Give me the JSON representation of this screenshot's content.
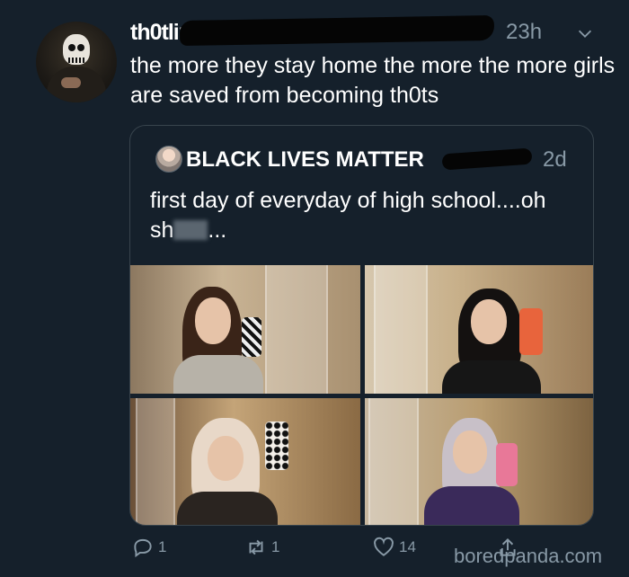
{
  "tweet": {
    "handle_fragment": "th0tline ...",
    "time": "23h",
    "text": "the more they stay home the more the more girls are saved from becoming th0ts"
  },
  "quoted_tweet": {
    "name": "BLACK LIVES MATTER",
    "time": "2d",
    "text_before": "first day of everyday of high school....oh sh",
    "text_after": "..."
  },
  "actions": {
    "reply_count": "1",
    "retweet_count": "1",
    "like_count": "14"
  },
  "watermark": "boredpanda.com",
  "icons": [
    "reply-icon",
    "retweet-icon",
    "like-icon",
    "share-icon",
    "chevron-down-icon"
  ]
}
